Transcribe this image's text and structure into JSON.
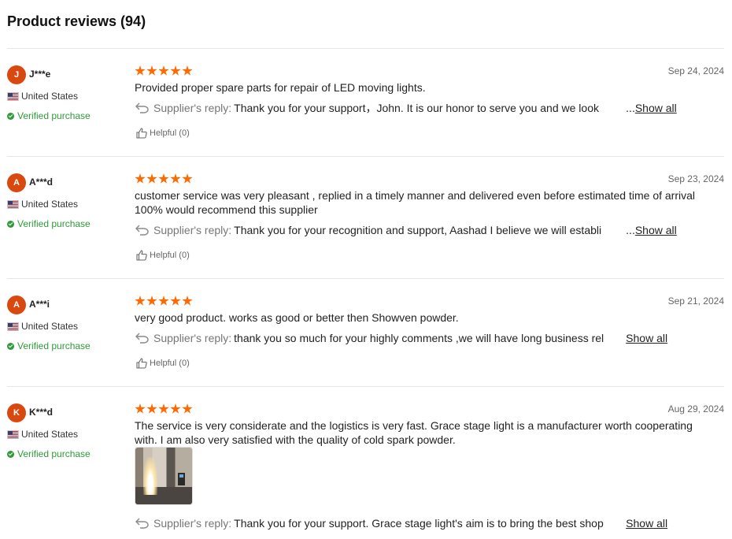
{
  "header": {
    "title": "Product reviews (94)"
  },
  "labels": {
    "verified": "Verified purchase",
    "supplier_reply": "Supplier's reply:",
    "ellipsis": "...",
    "show_all": "Show all",
    "helpful": "Helpful (0)"
  },
  "colors": {
    "accent_star": "#ff6a00",
    "avatar_bg": "#d9480f",
    "verified_green": "#2f9a3a"
  },
  "reviews": [
    {
      "initial": "J",
      "name": "J***e",
      "country": "United States",
      "rating": 5,
      "date": "Sep 24, 2024",
      "text": "Provided proper spare parts for repair of LED moving lights.",
      "reply": "Thank you for your support，John. It is our honor to serve you and we look"
    },
    {
      "initial": "A",
      "name": "A***d",
      "country": "United States",
      "rating": 5,
      "date": "Sep 23, 2024",
      "text": "customer service was very pleasant , replied in a timely manner and delivered even before estimated time of arrival 100% would recommend this supplier",
      "reply": "Thank you for your recognition and support, Aashad I believe we will establi"
    },
    {
      "initial": "A",
      "name": "A***i",
      "country": "United States",
      "rating": 5,
      "date": "Sep 21, 2024",
      "text": "very good product. works as good or better then Showven powder.",
      "reply": "thank you so much for your highly comments ,we will have long business rel"
    },
    {
      "initial": "K",
      "name": "K***d",
      "country": "United States",
      "rating": 5,
      "date": "Aug 29, 2024",
      "text": "The service is very considerate and the logistics is very fast. Grace stage light is a manufacturer worth cooperating with. I am also very satisfied with the quality of cold spark powder.",
      "reply": "Thank you for your support. Grace stage light's aim is to bring the best shop"
    }
  ]
}
